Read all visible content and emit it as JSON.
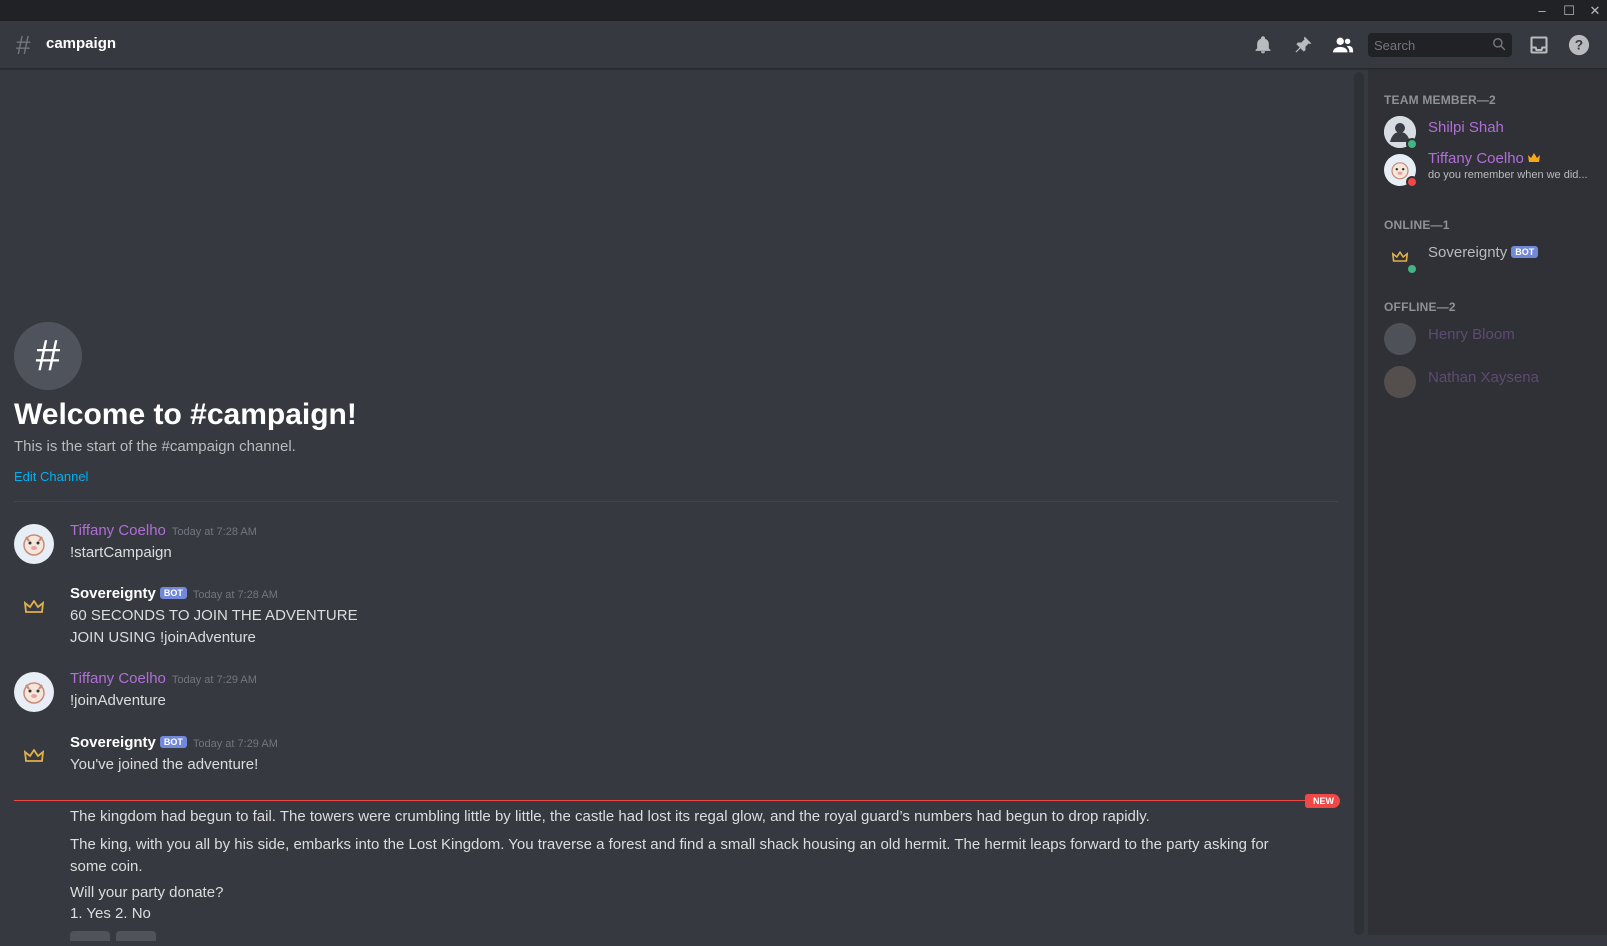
{
  "window": {
    "minimize": "–",
    "maximize": "☐",
    "close": "✕"
  },
  "header": {
    "channel_hash": "#",
    "channel_name": "campaign",
    "search_placeholder": "Search"
  },
  "welcome": {
    "icon": "#",
    "title": "Welcome to #campaign!",
    "subtitle": "This is the start of the #campaign channel.",
    "edit_link": "Edit Channel"
  },
  "messages": [
    {
      "author": "Tiffany Coelho",
      "timestamp": "Today at 7:28 AM",
      "lines": [
        "!startCampaign"
      ]
    },
    {
      "author": "Sovereignty",
      "badge": "BOT",
      "timestamp": "Today at 7:28 AM",
      "lines": [
        "60 SECONDS TO JOIN THE ADVENTURE",
        "JOIN USING !joinAdventure"
      ]
    },
    {
      "author": "Tiffany Coelho",
      "timestamp": "Today at 7:29 AM",
      "lines": [
        "!joinAdventure"
      ]
    },
    {
      "author": "Sovereignty",
      "badge": "BOT",
      "timestamp": "Today at 7:29 AM",
      "lines": [
        "You've joined the adventure!"
      ]
    }
  ],
  "new_badge": "NEW",
  "story": {
    "p1": "The kingdom had begun to fail. The towers were crumbling little by little, the castle had lost its regal glow, and the royal guard’s numbers had begun to drop rapidly.",
    "p2a": "The king, with you all by his side, embarks into the Lost Kingdom. You traverse a forest and find a small shack housing an old hermit. The hermit leaps forward to the party asking for",
    "p2b": "some coin.",
    "question": "Will your party donate?",
    "options": " 1. Yes 2. No"
  },
  "members": {
    "cat_team": "TEAM MEMBER—2",
    "cat_online": "ONLINE—1",
    "cat_offline": "OFFLINE—2",
    "list": [
      {
        "name": "Shilpi Shah"
      },
      {
        "name": "Tiffany Coelho",
        "activity": "do you remember when we did..."
      },
      {
        "name": "Sovereignty",
        "badge": "BOT"
      },
      {
        "name": "Henry Bloom"
      },
      {
        "name": "Nathan Xaysena"
      }
    ]
  },
  "colors": {
    "accent_purple": "#b16ed8",
    "link_blue": "#00b0f4",
    "new_red": "#f04747",
    "bot_blurple": "#7289da",
    "online_green": "#43b581",
    "dnd_red": "#f04747"
  }
}
